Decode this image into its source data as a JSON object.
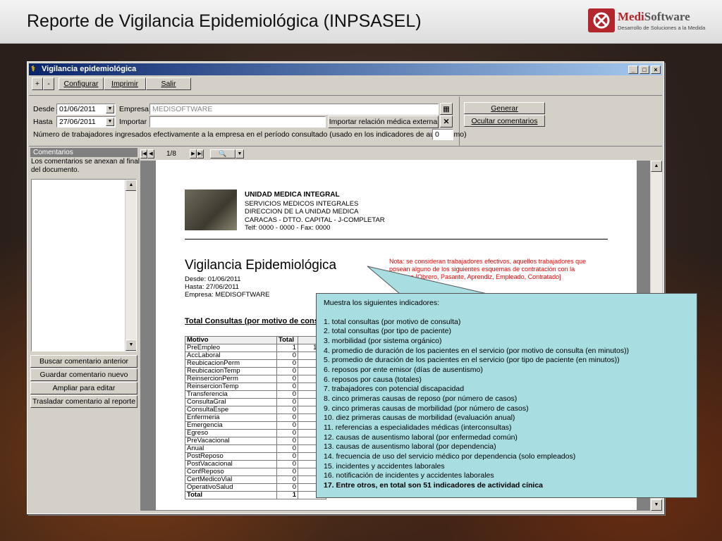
{
  "slide": {
    "title": "Reporte de Vigilancia Epidemiológica (INPSASEL)"
  },
  "logo": {
    "name_part1": "Medi",
    "name_part2": "Software",
    "tagline": "Desarrollo de Soluciones a la Medida"
  },
  "window": {
    "title": "Vigilancia epidemiológica",
    "min": "_",
    "max": "□",
    "close": "×"
  },
  "toolbar": {
    "plus": "+",
    "minus": "-",
    "configurar": "Configurar",
    "imprimir": "Imprimir",
    "salir": "Salir"
  },
  "form": {
    "desde_label": "Desde",
    "desde_value": "01/06/2011",
    "hasta_label": "Hasta",
    "hasta_value": "27/06/2011",
    "empresa_label": "Empresa",
    "empresa_value": "MEDISOFTWARE",
    "importar_label": "Importar",
    "importar_value": "",
    "importar_button": "Importar relación médica externa",
    "trabajadores_label": "Número de trabajadores ingresados efectivamente a la empresa en el período consultado (usado en los indicadores de ausentismo)",
    "trabajadores_value": "0",
    "generar": "Generar",
    "ocultar": "Ocultar comentarios"
  },
  "comments": {
    "title": "Comentarios",
    "description_line1": "Los comentarios se anexan al final",
    "description_line2": "del documento.",
    "buscar": "Buscar comentario anterior",
    "guardar": "Guardar comentario nuevo",
    "ampliar": "Ampliar para editar",
    "trasladar": "Trasladar comentario al reporte"
  },
  "viewer": {
    "page": "1/8"
  },
  "report": {
    "org_name": "UNIDAD MEDICA INTEGRAL",
    "org_line1": "SERVICIOS MEDICOS INTEGRALES",
    "org_line2": "DIRECCION DE LA UNIDAD MEDICA",
    "org_line3": "CARACAS - DTTO. CAPITAL - J-COMPLETAR",
    "org_line4": "Telf: 0000 - 0000 - Fax: 0000",
    "title": "Vigilancia Epidemiológica",
    "desde": "Desde: 01/06/2011",
    "hasta": "Hasta: 27/06/2011",
    "empresa": "Empresa: MEDISOFTWARE",
    "note_line1": "Nota: se consideran trabajadores efectivos, aquellos trabajadores que",
    "note_line2": "posean alguno de los siguientes esquemas de contratación con la",
    "note_line3": "empresa [Obrero, Pasante, Aprendiz, Empleado, Contratado]",
    "section": "Total Consultas (por motivo de consulta)",
    "table_headers": [
      "Motivo",
      "Total",
      ""
    ],
    "rows": [
      [
        "PreEmpleo",
        "1",
        "100"
      ],
      [
        "AccLaboral",
        "0",
        "0"
      ],
      [
        "ReubicacionPerm",
        "0",
        "0"
      ],
      [
        "ReubicacionTemp",
        "0",
        "0"
      ],
      [
        "ReinsercionPerm",
        "0",
        "0"
      ],
      [
        "ReinsercionTemp",
        "0",
        "0"
      ],
      [
        "Transferencia",
        "0",
        "0"
      ],
      [
        "ConsultaGral",
        "0",
        "0"
      ],
      [
        "ConsultaEspe",
        "0",
        "0"
      ],
      [
        "Enfermeria",
        "0",
        "0"
      ],
      [
        "Emergencia",
        "0",
        "0"
      ],
      [
        "Egreso",
        "0",
        "0"
      ],
      [
        "PreVacacional",
        "0",
        "0"
      ],
      [
        "Anual",
        "0",
        "0"
      ],
      [
        "PostReposo",
        "0",
        "0"
      ],
      [
        "PostVacacional",
        "0",
        "0"
      ],
      [
        "ConfReposo",
        "0",
        "0"
      ],
      [
        "CertMedicoVial",
        "0",
        "0"
      ],
      [
        "OperativoSalud",
        "0",
        "0"
      ],
      [
        "Total",
        "1",
        "1"
      ]
    ]
  },
  "callout": {
    "heading": "Muestra los siguientes indicadores:",
    "items": [
      "1. total consultas (por motivo de consulta)",
      "2. total consultas (por tipo de paciente)",
      "3. morbilidad (por sistema orgánico)",
      "4. promedio de duración de los pacientes en el servicio (por motivo de consulta (en minutos))",
      "5. promedio de duración de los pacientes en el servicio (por tipo de paciente (en minutos))",
      "6. reposos por ente emisor (días de ausentismo)",
      "6. reposos por causa (totales)",
      "7. trabajadores con potencial discapacidad",
      "8. cinco primeras causas de reposo (por número de casos)",
      "9. cinco primeras causas de morbilidad (por número de casos)",
      "10. diez primeras causas de morbilidad (evaluación anual)",
      "11. referencias a especialidades médicas (interconsultas)",
      "12. causas de ausentismo laboral (por enfermedad común)",
      "13. causas de ausentismo laboral (por dependencia)",
      "14. frecuencia de uso del servicio médico por dependencia (solo empleados)",
      "15. incidentes y accidentes laborales",
      "16. notificación de incidentes y accidentes laborales"
    ],
    "final": "17. Entre otros, en total son 51 indicadores de actividad cínica"
  }
}
